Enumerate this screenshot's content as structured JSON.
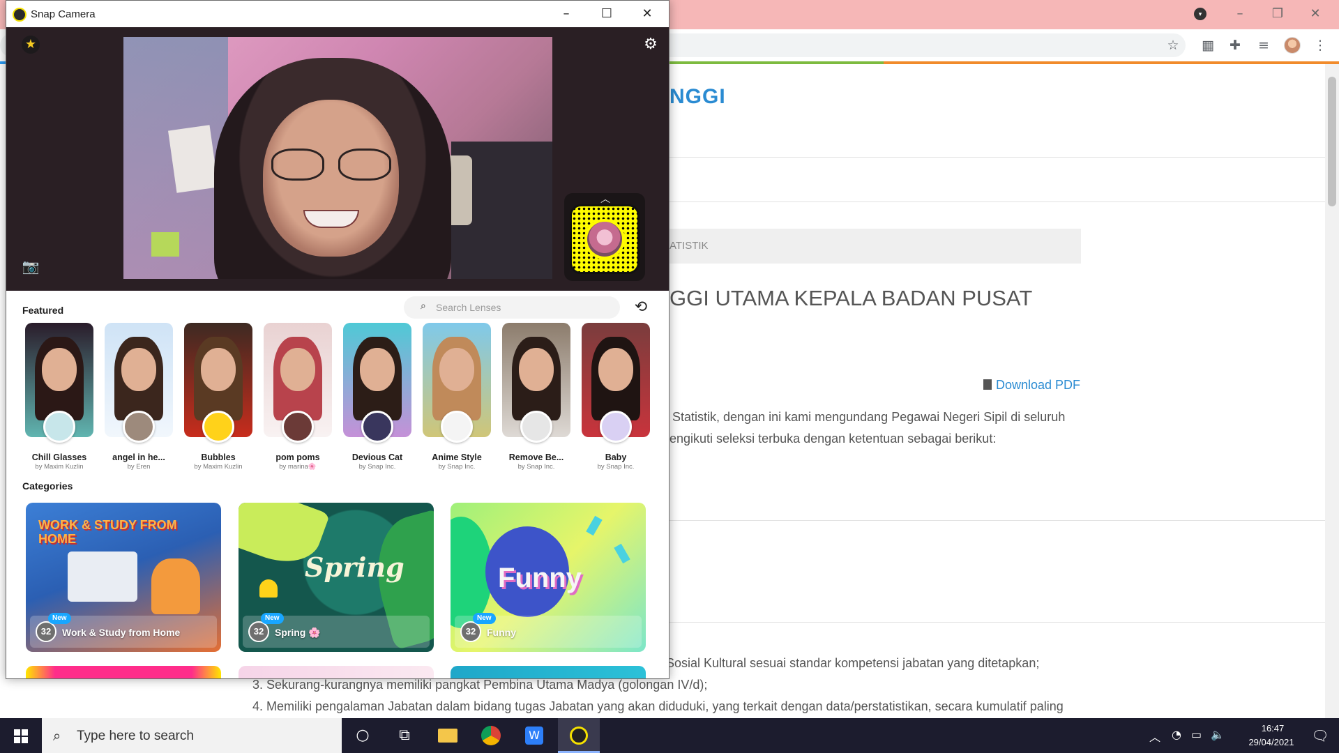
{
  "browser": {
    "site_title": "NGGI",
    "breadcrumb": "ATISTIK",
    "article_title": "GGI UTAMA KEPALA BADAN PUSAT",
    "download_label": "Download PDF",
    "body_lines": [
      "Statistik, dengan ini kami mengundang Pegawai Negeri Sipil di seluruh",
      "engikuti seleksi terbuka dengan ketentuan sebagai berikut:",
      "Sosial Kultural sesuai standar kompetensi jabatan yang ditetapkan;",
      "3. Sekurang-kurangnya memiliki pangkat Pembina Utama Madya (golongan IV/d);",
      "4. Memiliki pengalaman Jabatan dalam bidang tugas Jabatan yang akan diduduki, yang terkait dengan data/perstatistikan, secara kumulatif paling"
    ],
    "toolbar_icons": [
      "star-icon",
      "qr-icon",
      "extensions-icon",
      "media-icon",
      "profile-avatar",
      "more-icon"
    ]
  },
  "snap": {
    "window_title": "Snap Camera",
    "featured_heading": "Featured",
    "search_placeholder": "Search Lenses",
    "categories_heading": "Categories",
    "lenses": [
      {
        "name": "Chill Glasses",
        "author": "by Maxim Kuzlin",
        "bg": "#2a1c2a",
        "accent": "#76f2e6",
        "hair": "#2b1816",
        "avatar": "#c7e6ea"
      },
      {
        "name": "angel in he...",
        "author": "by Eren",
        "bg": "#cfe3f6",
        "accent": "#ffffff",
        "hair": "#3b261d",
        "avatar": "#9d8a7c"
      },
      {
        "name": "Bubbles",
        "author": "by Maxim Kuzlin",
        "bg": "#3d2a22",
        "accent": "#ff2d1a",
        "hair": "#5a3a23",
        "avatar": "#ffd21a"
      },
      {
        "name": "pom poms",
        "author": "by marina🌸",
        "bg": "#e9d2d2",
        "accent": "#ffffff",
        "hair": "#b8434c",
        "avatar": "#6b3a37"
      },
      {
        "name": "Devious Cat",
        "author": "by Snap Inc.",
        "bg": "#4fc9d6",
        "accent": "#f47ad8",
        "hair": "#2c1d17",
        "avatar": "#39365d"
      },
      {
        "name": "Anime Style",
        "author": "by Snap Inc.",
        "bg": "#7fc9ea",
        "accent": "#f0c54a",
        "hair": "#c08a5a",
        "avatar": "#f4f4f4"
      },
      {
        "name": "Remove Be...",
        "author": "by Snap Inc.",
        "bg": "#8c7c6c",
        "accent": "#ffffff",
        "hair": "#2b1d18",
        "avatar": "#e6e6e6"
      },
      {
        "name": "Baby",
        "author": "by Snap Inc.",
        "bg": "#7a3d3d",
        "accent": "#e8303b",
        "hair": "#1f1412",
        "avatar": "#d9d0f3"
      }
    ],
    "categories": [
      {
        "label": "Work & Study from Home",
        "count": "32",
        "badge": "New",
        "art_text": "WORK & STUDY FROM HOME"
      },
      {
        "label": "Spring 🌸",
        "count": "32",
        "badge": "New",
        "art_text": "Spring"
      },
      {
        "label": "Funny",
        "count": "32",
        "badge": "New",
        "art_text": "Funny"
      }
    ]
  },
  "taskbar": {
    "search_placeholder": "Type here to search",
    "time": "16:47",
    "date": "29/04/2021",
    "apps": [
      "cortana-icon",
      "task-view-icon",
      "file-explorer-icon",
      "chrome-icon",
      "wps-icon",
      "snap-camera-icon"
    ]
  }
}
